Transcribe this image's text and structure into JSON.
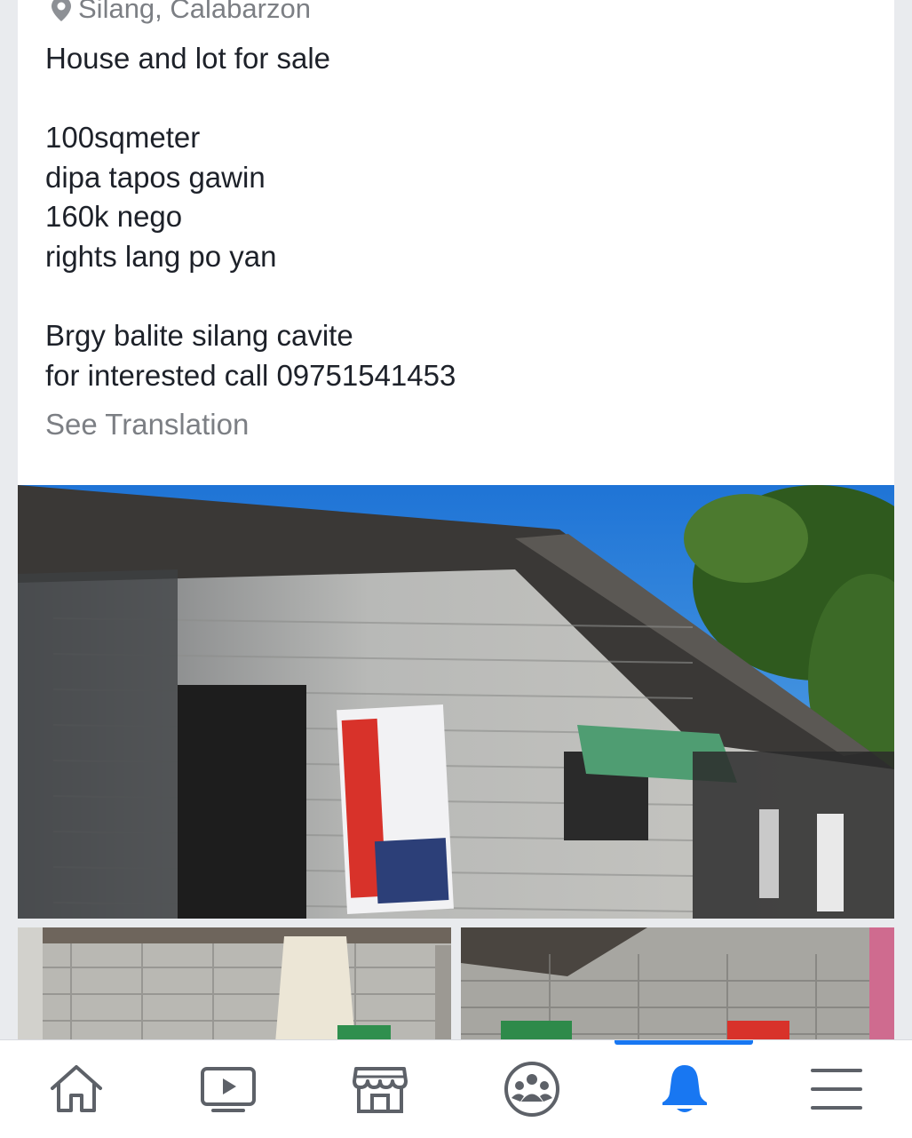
{
  "post": {
    "location": "Silang, Calabarzon",
    "text_lines": [
      "House and lot for sale",
      "",
      "100sqmeter",
      "dipa tapos gawin",
      "160k nego",
      "rights lang po yan",
      "",
      "Brgy balite silang cavite",
      "for interested call 09751541453"
    ],
    "see_translation": "See Translation"
  },
  "photos": {
    "main_description": "photo-house-exterior",
    "left_description": "photo-house-interior-1",
    "right_description": "photo-house-interior-2"
  },
  "tabbar": {
    "tabs": [
      {
        "icon": "home-icon",
        "active": false
      },
      {
        "icon": "video-icon",
        "active": false
      },
      {
        "icon": "marketplace-icon",
        "active": false
      },
      {
        "icon": "groups-icon",
        "active": false
      },
      {
        "icon": "notifications-icon",
        "active": true
      },
      {
        "icon": "menu-icon",
        "active": false
      }
    ],
    "active_color": "#1877f2",
    "inactive_color": "#5d6168"
  }
}
